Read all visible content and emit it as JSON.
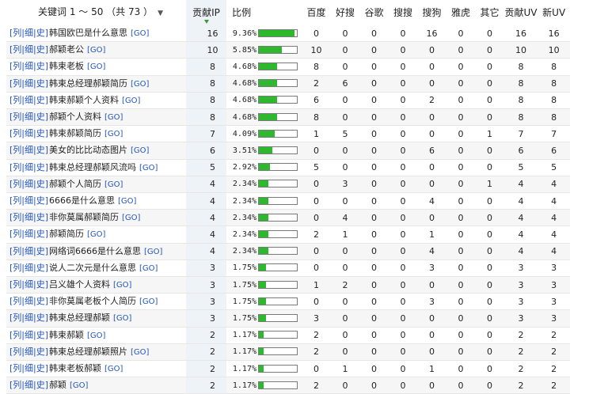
{
  "header": {
    "keyword": "关键词 1 ～ 50 （共 73 ）",
    "keyword_arrow": "▼",
    "ip": "贡献IP",
    "pct": "比例",
    "baidu": "百度",
    "haosou": "好搜",
    "google": "谷歌",
    "sogou": "搜搜",
    "sougou": "搜狗",
    "yahoo": "雅虎",
    "other": "其它",
    "uv": "贡献UV",
    "newuv": "新UV"
  },
  "row_links": {
    "list": "列",
    "detail": "细",
    "history": "史",
    "go": "[GO]"
  },
  "colors": {
    "bar_fill": "#2db82d",
    "link": "#2255bb",
    "sorted_column": "#eef3f8"
  },
  "rows": [
    {
      "word": "韩国欧巴是什么意思",
      "ip": "16",
      "pct": "9.36%",
      "share": 0.936,
      "baidu": "0",
      "haosou": "0",
      "google": "0",
      "sogou": "0",
      "sougou": "16",
      "yahoo": "0",
      "other": "0",
      "uv": "16",
      "newuv": "16"
    },
    {
      "word": "郝颖老公",
      "ip": "10",
      "pct": "5.85%",
      "share": 0.585,
      "baidu": "10",
      "haosou": "0",
      "google": "0",
      "sogou": "0",
      "sougou": "0",
      "yahoo": "0",
      "other": "0",
      "uv": "10",
      "newuv": "10"
    },
    {
      "word": "韩束老板",
      "ip": "8",
      "pct": "4.68%",
      "share": 0.468,
      "baidu": "8",
      "haosou": "0",
      "google": "0",
      "sogou": "0",
      "sougou": "0",
      "yahoo": "0",
      "other": "0",
      "uv": "8",
      "newuv": "8"
    },
    {
      "word": "韩束总经理郝颖简历",
      "ip": "8",
      "pct": "4.68%",
      "share": 0.468,
      "baidu": "2",
      "haosou": "6",
      "google": "0",
      "sogou": "0",
      "sougou": "0",
      "yahoo": "0",
      "other": "0",
      "uv": "8",
      "newuv": "8"
    },
    {
      "word": "韩束郝颖个人资料",
      "ip": "8",
      "pct": "4.68%",
      "share": 0.468,
      "baidu": "6",
      "haosou": "0",
      "google": "0",
      "sogou": "0",
      "sougou": "2",
      "yahoo": "0",
      "other": "0",
      "uv": "8",
      "newuv": "8"
    },
    {
      "word": "郝颖个人资料",
      "ip": "8",
      "pct": "4.68%",
      "share": 0.468,
      "baidu": "8",
      "haosou": "0",
      "google": "0",
      "sogou": "0",
      "sougou": "0",
      "yahoo": "0",
      "other": "0",
      "uv": "8",
      "newuv": "8"
    },
    {
      "word": "韩束郝颖简历",
      "ip": "7",
      "pct": "4.09%",
      "share": 0.409,
      "baidu": "1",
      "haosou": "5",
      "google": "0",
      "sogou": "0",
      "sougou": "0",
      "yahoo": "0",
      "other": "1",
      "uv": "7",
      "newuv": "7"
    },
    {
      "word": "美女的比比动态图片",
      "ip": "6",
      "pct": "3.51%",
      "share": 0.351,
      "baidu": "0",
      "haosou": "0",
      "google": "0",
      "sogou": "0",
      "sougou": "6",
      "yahoo": "0",
      "other": "0",
      "uv": "6",
      "newuv": "6"
    },
    {
      "word": "韩束总经理郝颖风流吗",
      "ip": "5",
      "pct": "2.92%",
      "share": 0.292,
      "baidu": "5",
      "haosou": "0",
      "google": "0",
      "sogou": "0",
      "sougou": "0",
      "yahoo": "0",
      "other": "0",
      "uv": "5",
      "newuv": "5"
    },
    {
      "word": "郝颖个人简历",
      "ip": "4",
      "pct": "2.34%",
      "share": 0.234,
      "baidu": "0",
      "haosou": "3",
      "google": "0",
      "sogou": "0",
      "sougou": "0",
      "yahoo": "0",
      "other": "1",
      "uv": "4",
      "newuv": "4"
    },
    {
      "word": "6666是什么意思",
      "ip": "4",
      "pct": "2.34%",
      "share": 0.234,
      "baidu": "0",
      "haosou": "0",
      "google": "0",
      "sogou": "0",
      "sougou": "4",
      "yahoo": "0",
      "other": "0",
      "uv": "4",
      "newuv": "4"
    },
    {
      "word": "非你莫属郝颖简历",
      "ip": "4",
      "pct": "2.34%",
      "share": 0.234,
      "baidu": "0",
      "haosou": "4",
      "google": "0",
      "sogou": "0",
      "sougou": "0",
      "yahoo": "0",
      "other": "0",
      "uv": "4",
      "newuv": "4"
    },
    {
      "word": "郝颖简历",
      "ip": "4",
      "pct": "2.34%",
      "share": 0.234,
      "baidu": "2",
      "haosou": "1",
      "google": "0",
      "sogou": "0",
      "sougou": "1",
      "yahoo": "0",
      "other": "0",
      "uv": "4",
      "newuv": "4"
    },
    {
      "word": "网络词6666是什么意思",
      "ip": "4",
      "pct": "2.34%",
      "share": 0.234,
      "baidu": "0",
      "haosou": "0",
      "google": "0",
      "sogou": "0",
      "sougou": "4",
      "yahoo": "0",
      "other": "0",
      "uv": "4",
      "newuv": "4"
    },
    {
      "word": "说人二次元是什么意思",
      "ip": "3",
      "pct": "1.75%",
      "share": 0.175,
      "baidu": "0",
      "haosou": "0",
      "google": "0",
      "sogou": "0",
      "sougou": "3",
      "yahoo": "0",
      "other": "0",
      "uv": "3",
      "newuv": "3"
    },
    {
      "word": "吕义雄个人资料",
      "ip": "3",
      "pct": "1.75%",
      "share": 0.175,
      "baidu": "1",
      "haosou": "2",
      "google": "0",
      "sogou": "0",
      "sougou": "0",
      "yahoo": "0",
      "other": "0",
      "uv": "3",
      "newuv": "3"
    },
    {
      "word": "非你莫属老板个人简历",
      "ip": "3",
      "pct": "1.75%",
      "share": 0.175,
      "baidu": "0",
      "haosou": "0",
      "google": "0",
      "sogou": "0",
      "sougou": "3",
      "yahoo": "0",
      "other": "0",
      "uv": "3",
      "newuv": "3"
    },
    {
      "word": "韩束总经理郝颖",
      "ip": "3",
      "pct": "1.75%",
      "share": 0.175,
      "baidu": "3",
      "haosou": "0",
      "google": "0",
      "sogou": "0",
      "sougou": "0",
      "yahoo": "0",
      "other": "0",
      "uv": "3",
      "newuv": "3"
    },
    {
      "word": "韩束郝颖",
      "ip": "2",
      "pct": "1.17%",
      "share": 0.117,
      "baidu": "2",
      "haosou": "0",
      "google": "0",
      "sogou": "0",
      "sougou": "0",
      "yahoo": "0",
      "other": "0",
      "uv": "2",
      "newuv": "2"
    },
    {
      "word": "韩束总经理郝颖照片",
      "ip": "2",
      "pct": "1.17%",
      "share": 0.117,
      "baidu": "2",
      "haosou": "0",
      "google": "0",
      "sogou": "0",
      "sougou": "0",
      "yahoo": "0",
      "other": "0",
      "uv": "2",
      "newuv": "2"
    },
    {
      "word": "韩束老板郝颖",
      "ip": "2",
      "pct": "1.17%",
      "share": 0.117,
      "baidu": "0",
      "haosou": "1",
      "google": "0",
      "sogou": "0",
      "sougou": "1",
      "yahoo": "0",
      "other": "0",
      "uv": "2",
      "newuv": "2"
    },
    {
      "word": "郝颖",
      "ip": "2",
      "pct": "1.17%",
      "share": 0.117,
      "baidu": "2",
      "haosou": "0",
      "google": "0",
      "sogou": "0",
      "sougou": "0",
      "yahoo": "0",
      "other": "0",
      "uv": "2",
      "newuv": "2"
    }
  ]
}
